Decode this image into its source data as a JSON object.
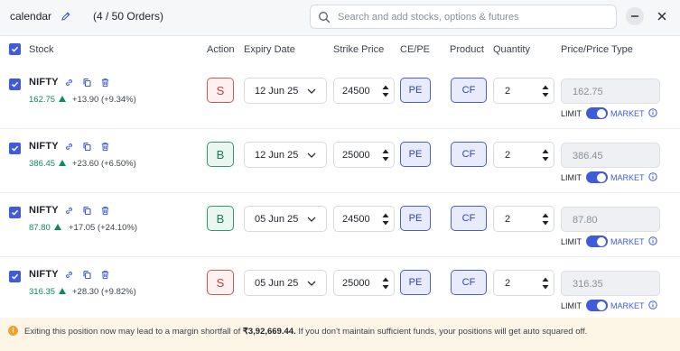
{
  "header": {
    "basket_name": "calendar",
    "order_count": "(4 / 50 Orders)",
    "search_placeholder": "Search and add stocks, options & futures"
  },
  "columns": {
    "stock": "Stock",
    "action": "Action",
    "expiry": "Expiry Date",
    "strike": "Strike Price",
    "cepe": "CE/PE",
    "product": "Product",
    "quantity": "Quantity",
    "price_type": "Price/Price Type"
  },
  "rows": [
    {
      "symbol": "NIFTY",
      "ltp": "162.75",
      "change": "+13.90 (+9.34%)",
      "action": "S",
      "expiry": "12 Jun 25",
      "strike": "24500",
      "cepe": "PE",
      "product": "CF",
      "quantity": "2",
      "price": "162.75",
      "limit_label": "LIMIT",
      "market_label": "MARKET"
    },
    {
      "symbol": "NIFTY",
      "ltp": "386.45",
      "change": "+23.60 (+6.50%)",
      "action": "B",
      "expiry": "12 Jun 25",
      "strike": "25000",
      "cepe": "PE",
      "product": "CF",
      "quantity": "2",
      "price": "386.45",
      "limit_label": "LIMIT",
      "market_label": "MARKET"
    },
    {
      "symbol": "NIFTY",
      "ltp": "87.80",
      "change": "+17.05 (+24.10%)",
      "action": "B",
      "expiry": "05 Jun 25",
      "strike": "24500",
      "cepe": "PE",
      "product": "CF",
      "quantity": "2",
      "price": "87.80",
      "limit_label": "LIMIT",
      "market_label": "MARKET"
    },
    {
      "symbol": "NIFTY",
      "ltp": "316.35",
      "change": "+28.30 (+9.82%)",
      "action": "S",
      "expiry": "05 Jun 25",
      "strike": "25000",
      "cepe": "PE",
      "product": "CF",
      "quantity": "2",
      "price": "316.35",
      "limit_label": "LIMIT",
      "market_label": "MARKET"
    }
  ],
  "banner": {
    "prefix": "Exiting this position now may lead to a margin shortfall of ",
    "amount": "₹3,92,669.44.",
    "suffix": " If you don't maintain sufficient funds, your positions will get auto squared off."
  },
  "colors": {
    "accent": "#3f5bd9",
    "buy": "#2d9d6f",
    "sell": "#d9534f",
    "gain": "#0f8a5f",
    "warning_bg": "#fdf5e6"
  }
}
